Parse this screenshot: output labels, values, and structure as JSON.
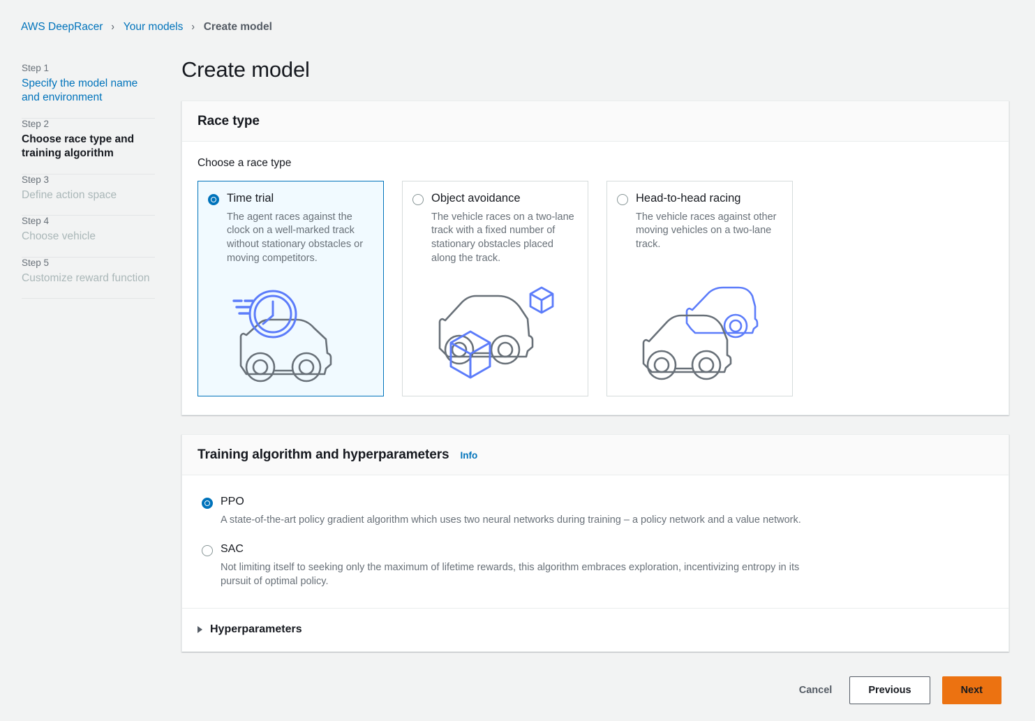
{
  "breadcrumb": {
    "items": [
      {
        "label": "AWS DeepRacer",
        "type": "link"
      },
      {
        "label": "Your models",
        "type": "link"
      },
      {
        "label": "Create model",
        "type": "current"
      }
    ],
    "separator": "›"
  },
  "sidebar": {
    "steps": [
      {
        "num": "Step 1",
        "name": "Specify the model name and environment",
        "state": "link"
      },
      {
        "num": "Step 2",
        "name": "Choose race type and training algorithm",
        "state": "active"
      },
      {
        "num": "Step 3",
        "name": "Define action space",
        "state": "disabled"
      },
      {
        "num": "Step 4",
        "name": "Choose vehicle",
        "state": "disabled"
      },
      {
        "num": "Step 5",
        "name": "Customize reward function",
        "state": "disabled"
      }
    ]
  },
  "main": {
    "title": "Create model",
    "race_type": {
      "header": "Race type",
      "field_label": "Choose a race type",
      "options": [
        {
          "id": "time-trial",
          "label": "Time trial",
          "description": "The agent races against the clock on a well-marked track without stationary obstacles or moving competitors.",
          "selected": true,
          "art": "car-with-clock"
        },
        {
          "id": "object-avoidance",
          "label": "Object avoidance",
          "description": "The vehicle races on a two-lane track with a fixed number of stationary obstacles placed along the track.",
          "selected": false,
          "art": "car-with-boxes"
        },
        {
          "id": "head-to-head",
          "label": "Head-to-head racing",
          "description": "The vehicle races against other moving vehicles on a two-lane track.",
          "selected": false,
          "art": "two-cars"
        }
      ]
    },
    "algorithm": {
      "header": "Training algorithm and hyperparameters",
      "info_label": "Info",
      "options": [
        {
          "id": "ppo",
          "label": "PPO",
          "description": "A state-of-the-art policy gradient algorithm which uses two neural networks during training – a policy network and a value network.",
          "selected": true
        },
        {
          "id": "sac",
          "label": "SAC",
          "description": "Not limiting itself to seeking only the maximum of lifetime rewards, this algorithm embraces exploration, incentivizing entropy in its pursuit of optimal policy.",
          "selected": false
        }
      ],
      "expander_label": "Hyperparameters"
    }
  },
  "footer": {
    "cancel_label": "Cancel",
    "previous_label": "Previous",
    "next_label": "Next"
  },
  "colors": {
    "link": "#0073bb",
    "primary_button": "#ec7211",
    "selected_tile_bg": "#f1faff",
    "page_bg": "#f2f3f3",
    "art_gray": "#687078",
    "art_blue": "#5c7cfa"
  }
}
